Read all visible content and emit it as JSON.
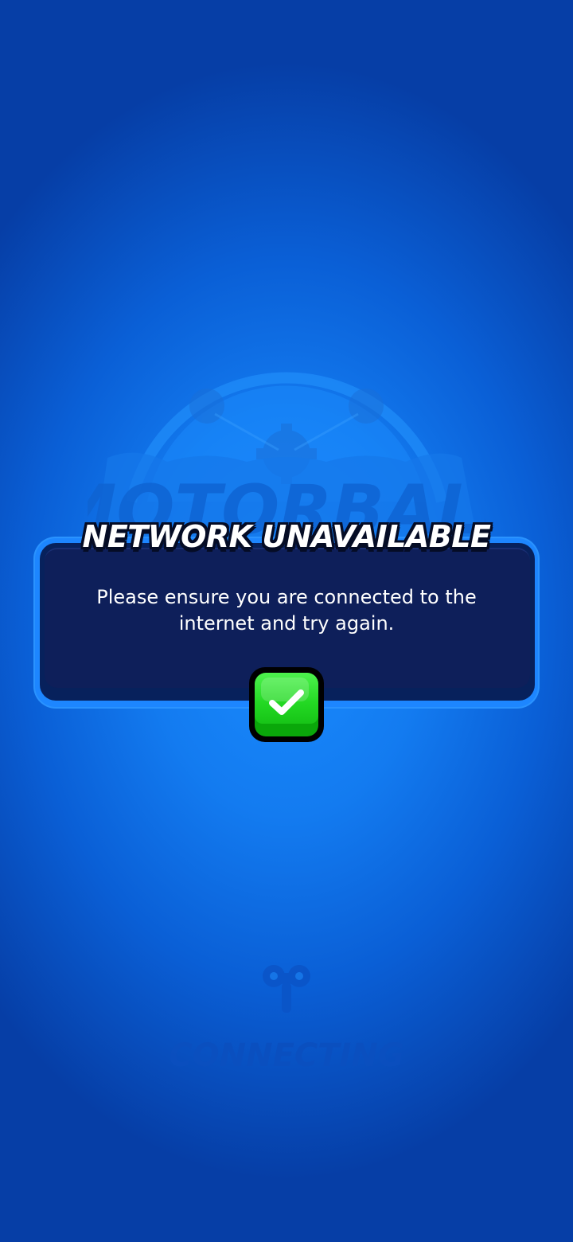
{
  "background": {
    "logo_text": "MOTORBALL",
    "colors": {
      "center": "#1a8cff",
      "edge": "#063ea6"
    }
  },
  "dialog": {
    "title": "NETWORK UNAVAILABLE",
    "message": "Please ensure you are connected to the internet and try again.",
    "confirm_icon": "check-icon",
    "colors": {
      "panel": "#0e1f5a",
      "border": "#1d86ff",
      "button": "#23d823"
    }
  },
  "status": {
    "icon": "key-icon",
    "label": "CONNECTING"
  }
}
